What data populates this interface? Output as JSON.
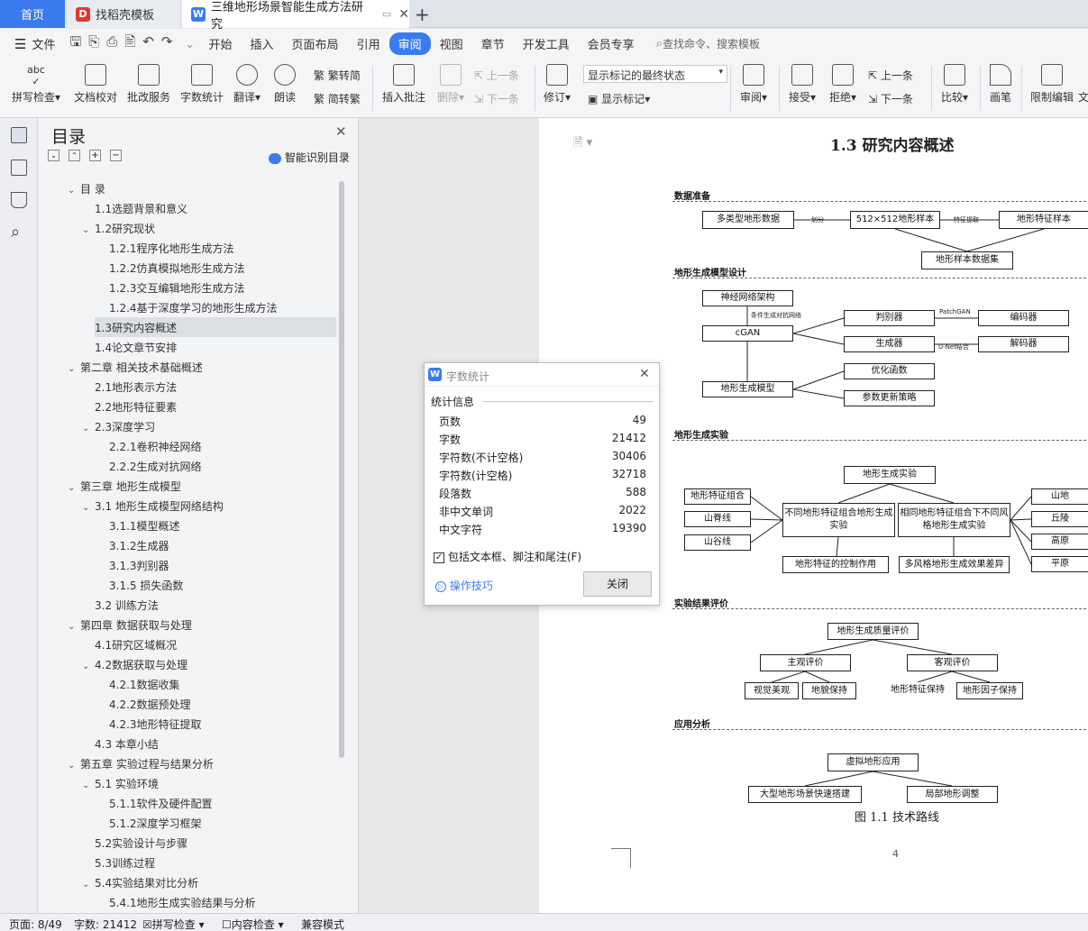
{
  "tabs": {
    "home": "首页",
    "template": "找稻壳模板",
    "document": "三维地形场景智能生成方法研究"
  },
  "menubar": {
    "file": "文件",
    "items": [
      "开始",
      "插入",
      "页面布局",
      "引用",
      "审阅",
      "视图",
      "章节",
      "开发工具",
      "会员专享"
    ],
    "active": "审阅",
    "search": "查找命令、搜索模板"
  },
  "ribbon": {
    "spell": "拼写检查",
    "doc_check": "文档校对",
    "batch": "批改服务",
    "word_count": "字数统计",
    "translate": "翻译",
    "read": "朗读",
    "trad": "繁转简",
    "simp": "简转繁",
    "insert_comment": "插入批注",
    "delete": "删除",
    "prev": "上一条",
    "next": "下一条",
    "revise": "修订",
    "markup_state": "显示标记的最终状态",
    "show_markup": "显示标记",
    "review": "审阅",
    "accept": "接受",
    "reject": "拒绝",
    "prev2": "上一条",
    "next2": "下一条",
    "compare": "比较",
    "pen": "画笔",
    "restrict": "限制编辑",
    "doc": "文"
  },
  "toc": {
    "title": "目录",
    "smart": "智能识别目录",
    "items": [
      {
        "t": "目 录",
        "l": 0,
        "a": "v"
      },
      {
        "t": "1.1选题背景和意义",
        "l": 1,
        "a": ""
      },
      {
        "t": "1.2研究现状",
        "l": 1,
        "a": "v"
      },
      {
        "t": "1.2.1程序化地形生成方法",
        "l": 2,
        "a": ""
      },
      {
        "t": "1.2.2仿真模拟地形生成方法",
        "l": 2,
        "a": ""
      },
      {
        "t": "1.2.3交互编辑地形生成方法",
        "l": 2,
        "a": ""
      },
      {
        "t": "1.2.4基于深度学习的地形生成方法",
        "l": 2,
        "a": ""
      },
      {
        "t": "1.3研究内容概述",
        "l": 1,
        "a": ""
      },
      {
        "t": "1.4论文章节安排",
        "l": 1,
        "a": ""
      },
      {
        "t": "第二章 相关技术基础概述",
        "l": 0,
        "a": "v"
      },
      {
        "t": "2.1地形表示方法",
        "l": 1,
        "a": ""
      },
      {
        "t": "2.2地形特征要素",
        "l": 1,
        "a": ""
      },
      {
        "t": "2.3深度学习",
        "l": 1,
        "a": "v"
      },
      {
        "t": "2.2.1卷积神经网络",
        "l": 2,
        "a": ""
      },
      {
        "t": "2.2.2生成对抗网络",
        "l": 2,
        "a": ""
      },
      {
        "t": "第三章 地形生成模型",
        "l": 0,
        "a": "v"
      },
      {
        "t": "3.1 地形生成模型网络结构",
        "l": 1,
        "a": "v"
      },
      {
        "t": "3.1.1模型概述",
        "l": 2,
        "a": ""
      },
      {
        "t": "3.1.2生成器",
        "l": 2,
        "a": ""
      },
      {
        "t": "3.1.3判别器",
        "l": 2,
        "a": ""
      },
      {
        "t": "3.1.5 损失函数",
        "l": 2,
        "a": ""
      },
      {
        "t": "3.2 训练方法",
        "l": 1,
        "a": ""
      },
      {
        "t": "第四章 数据获取与处理",
        "l": 0,
        "a": "v"
      },
      {
        "t": "4.1研究区域概况",
        "l": 1,
        "a": ""
      },
      {
        "t": "4.2数据获取与处理",
        "l": 1,
        "a": "v"
      },
      {
        "t": "4.2.1数据收集",
        "l": 2,
        "a": ""
      },
      {
        "t": "4.2.2数据预处理",
        "l": 2,
        "a": ""
      },
      {
        "t": "4.2.3地形特征提取",
        "l": 2,
        "a": ""
      },
      {
        "t": "4.3 本章小结",
        "l": 1,
        "a": ""
      },
      {
        "t": "第五章 实验过程与结果分析",
        "l": 0,
        "a": "v"
      },
      {
        "t": "5.1 实验环境",
        "l": 1,
        "a": "v"
      },
      {
        "t": "5.1.1软件及硬件配置",
        "l": 2,
        "a": ""
      },
      {
        "t": "5.1.2深度学习框架",
        "l": 2,
        "a": ""
      },
      {
        "t": "5.2实验设计与步骤",
        "l": 1,
        "a": ""
      },
      {
        "t": "5.3训练过程",
        "l": 1,
        "a": ""
      },
      {
        "t": "5.4实验结果对比分析",
        "l": 1,
        "a": "v"
      },
      {
        "t": "5.4.1地形生成实验结果与分析",
        "l": 2,
        "a": ""
      }
    ]
  },
  "dialog": {
    "title": "字数统计",
    "section": "统计信息",
    "rows": [
      {
        "k": "页数",
        "v": "49"
      },
      {
        "k": "字数",
        "v": "21412"
      },
      {
        "k": "字符数(不计空格)",
        "v": "30406"
      },
      {
        "k": "字符数(计空格)",
        "v": "32718"
      },
      {
        "k": "段落数",
        "v": "588"
      },
      {
        "k": "非中文单词",
        "v": "2022"
      },
      {
        "k": "中文字符",
        "v": "19390"
      }
    ],
    "checkbox": "包括文本框、脚注和尾注(F)",
    "tips": "操作技巧",
    "close": "关闭"
  },
  "doc": {
    "heading": "1.3  研究内容概述",
    "s1": "数据准备",
    "s1_boxes": [
      "多类型地形数据",
      "512×512地形样本",
      "地形特征样本",
      "地形样本数据集"
    ],
    "s1_labels": [
      "划分",
      "特征提取"
    ],
    "s2": "地形生成模型设计",
    "s2_boxes": [
      "神经网络架构",
      "cGAN",
      "地形生成模型",
      "判别器",
      "生成器",
      "编码器",
      "解码器",
      "优化函数",
      "参数更新策略"
    ],
    "s2_labels": [
      "条件生成对抗网络",
      "PatchGAN",
      "U-Net结合"
    ],
    "s3": "地形生成实验",
    "s3_boxes": [
      "地形生成实验",
      "地形特征组合",
      "山脊线",
      "山谷线",
      "不同地形特征组合地形生成实验",
      "相同地形特征组合下不同风格地形生成实验",
      "山地",
      "丘陵",
      "高原",
      "平原",
      "地形特征的控制作用",
      "多风格地形生成效果差异"
    ],
    "s4": "实验结果评价",
    "s4_boxes": [
      "地形生成质量评价",
      "主观评价",
      "客观评价",
      "视觉美观",
      "地貌保持",
      "地形特征保持",
      "地形因子保持"
    ],
    "s5": "应用分析",
    "s5_boxes": [
      "虚拟地形应用",
      "大型地形场景快速搭建",
      "局部地形调整"
    ],
    "caption": "图 1.1 技术路线",
    "page_no": "4"
  },
  "status": {
    "page": "页面: 8/49",
    "words": "字数: 21412",
    "spell": "拼写检查",
    "content": "内容检查",
    "compat": "兼容模式"
  },
  "colors": {
    "accent": "#3b7bf0",
    "wps_red": "#e0382f"
  }
}
